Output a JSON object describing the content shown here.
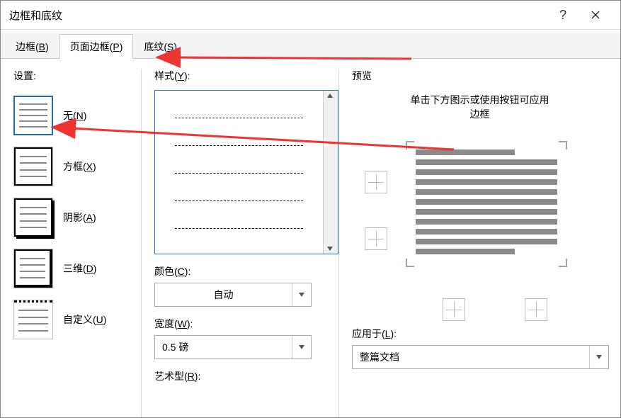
{
  "titlebar": {
    "title": "边框和底纹",
    "help": "?",
    "close": "×"
  },
  "tabs": [
    {
      "label": "边框(",
      "hot": "B",
      "suffix": ")"
    },
    {
      "label": "页面边框(",
      "hot": "P",
      "suffix": ")"
    },
    {
      "label": "底纹(",
      "hot": "S",
      "suffix": ")"
    }
  ],
  "settings": {
    "title": "设置:",
    "items": [
      {
        "label": "无(",
        "hot": "N",
        "suffix": ")"
      },
      {
        "label": "方框(",
        "hot": "X",
        "suffix": ")"
      },
      {
        "label": "阴影(",
        "hot": "A",
        "suffix": ")"
      },
      {
        "label": "三维(",
        "hot": "D",
        "suffix": ")"
      },
      {
        "label": "自定义(",
        "hot": "U",
        "suffix": ")"
      }
    ]
  },
  "style": {
    "title": "样式(",
    "hot": "Y",
    "suffix": "):",
    "color_label": "颜色(",
    "color_hot": "C",
    "color_suffix": "):",
    "color_value": "自动",
    "width_label": "宽度(",
    "width_hot": "W",
    "width_suffix": "):",
    "width_value": "0.5 磅",
    "art_label": "艺术型(",
    "art_hot": "R",
    "art_suffix": "):"
  },
  "preview": {
    "title": "预览",
    "hint1": "单击下方图示或使用按钮可应用",
    "hint2": "边框",
    "apply_label": "应用于(",
    "apply_hot": "L",
    "apply_suffix": "):",
    "apply_value": "整篇文档"
  }
}
